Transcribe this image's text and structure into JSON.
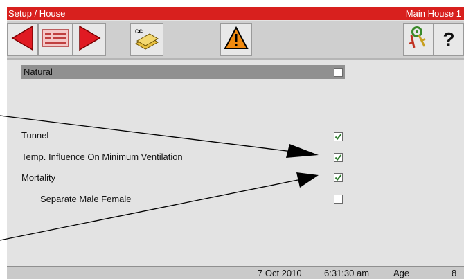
{
  "title_bar": {
    "section": "Setup / House",
    "house": "Main House 1"
  },
  "toolbar": {
    "prev_icon": "left-arrow-icon",
    "card_icon": "card-icon",
    "next_icon": "right-arrow-icon",
    "cc_badge": "cc",
    "warning_icon": "warning-icon",
    "key_icon": "key-icon",
    "help_label": "?"
  },
  "settings": {
    "natural": {
      "label": "Natural",
      "checked": false
    },
    "tunnel": {
      "label": "Tunnel",
      "checked": true
    },
    "temp_influence": {
      "label": "Temp. Influence On Minimum Ventilation",
      "checked": true
    },
    "mortality": {
      "label": "Mortality",
      "checked": true
    },
    "separate_male_female": {
      "label": "Separate Male Female",
      "checked": false
    }
  },
  "status_bar": {
    "date": "7 Oct 2010",
    "time": "6:31:30 am",
    "age_label": "Age",
    "age_value": "8"
  },
  "colors": {
    "title_red": "#d8201e",
    "arrow_red": "#e01a22",
    "warning_orange": "#f08a10",
    "check_green": "#2a7a2a"
  }
}
